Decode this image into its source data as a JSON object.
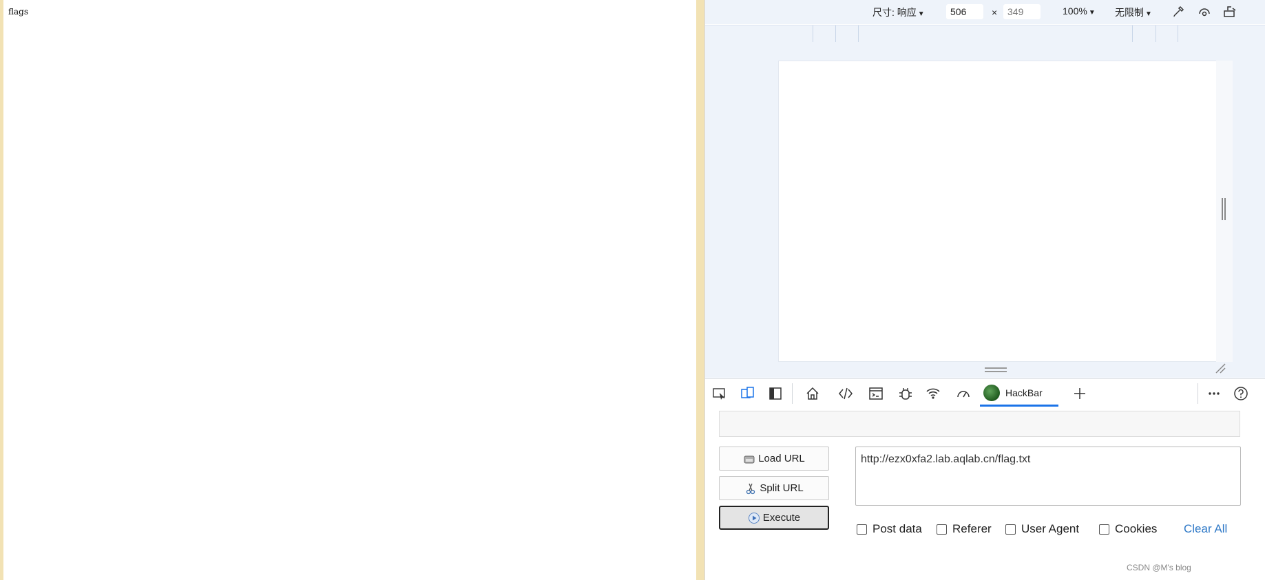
{
  "page": {
    "text": "flags"
  },
  "device_toolbar": {
    "size_label": "尺寸: 响应",
    "width_value": "506",
    "times": "×",
    "height_placeholder": "349",
    "zoom": "100%",
    "throttle": "无限制"
  },
  "tabs": {
    "hackbar_label": "HackBar"
  },
  "hackbar": {
    "load_url": "Load URL",
    "split_url": "Split URL",
    "execute": "Execute",
    "url_value": "http://ezx0xfa2.lab.aqlab.cn/flag.txt",
    "options": [
      "Post data",
      "Referer",
      "User Agent",
      "Cookies"
    ],
    "clear_all": "Clear All"
  },
  "watermark": "CSDN @M's blog",
  "colors": {
    "accent": "#1a73e8",
    "link": "#2f79c7",
    "page_border": "#f2e2b4",
    "toolbar_bg": "#eef3fa"
  }
}
